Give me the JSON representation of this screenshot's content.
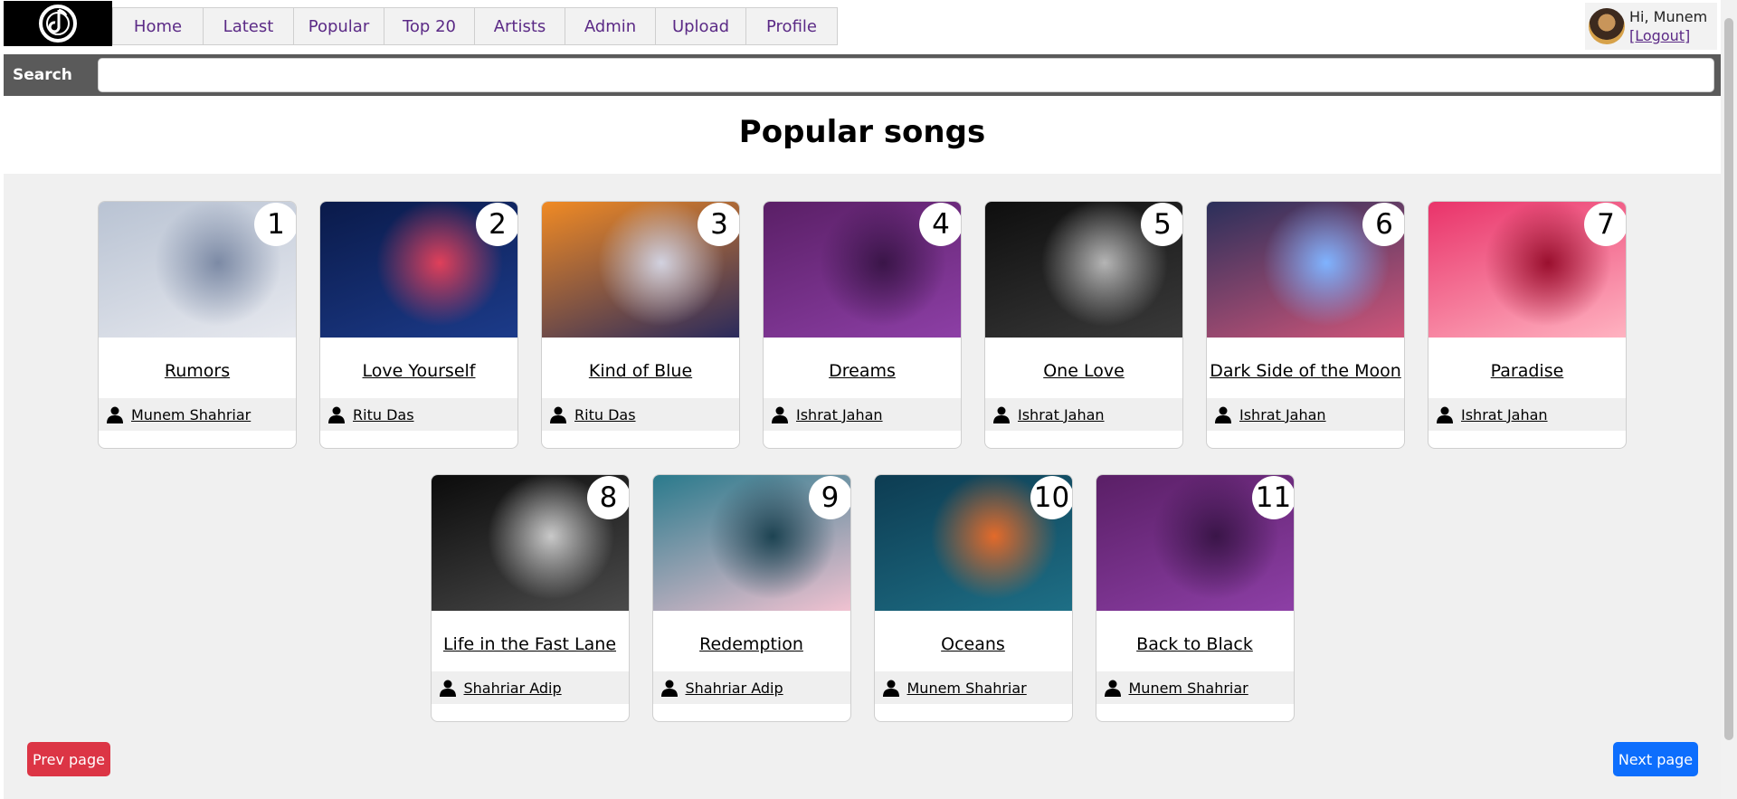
{
  "nav": {
    "items": [
      "Home",
      "Latest",
      "Popular",
      "Top 20",
      "Artists",
      "Admin",
      "Upload",
      "Profile"
    ]
  },
  "user": {
    "greeting": "Hi, Munem",
    "logout": "[Logout]"
  },
  "search": {
    "label": "Search",
    "value": ""
  },
  "page": {
    "title": "Popular songs"
  },
  "songs": [
    {
      "rank": "1",
      "title": "Rumors",
      "artist": "Munem Shahriar",
      "cover": [
        "#b9c3d3",
        "#e7e9ef",
        "#7c8aa5"
      ]
    },
    {
      "rank": "2",
      "title": "Love Yourself",
      "artist": "Ritu Das",
      "cover": [
        "#0a1a4a",
        "#1c3b8a",
        "#e0405a"
      ]
    },
    {
      "rank": "3",
      "title": "Kind of Blue",
      "artist": "Ritu Das",
      "cover": [
        "#f08a24",
        "#2a2a5c",
        "#d2d2e0"
      ]
    },
    {
      "rank": "4",
      "title": "Dreams",
      "artist": "Ishrat Jahan",
      "cover": [
        "#5a1f66",
        "#8d3fa6",
        "#3a1548"
      ]
    },
    {
      "rank": "5",
      "title": "One Love",
      "artist": "Ishrat Jahan",
      "cover": [
        "#0e0e0e",
        "#3a3a3a",
        "#b5b5b5"
      ]
    },
    {
      "rank": "6",
      "title": "Dark Side of the Moon",
      "artist": "Ishrat Jahan",
      "cover": [
        "#2a2f5a",
        "#d0567a",
        "#7fb3ff"
      ]
    },
    {
      "rank": "7",
      "title": "Paradise",
      "artist": "Ishrat Jahan",
      "cover": [
        "#e9336a",
        "#ffb3c1",
        "#9a0f2e"
      ]
    },
    {
      "rank": "8",
      "title": "Life in the Fast Lane",
      "artist": "Shahriar Adip",
      "cover": [
        "#0b0b0b",
        "#4b4b4b",
        "#c9c9c9"
      ]
    },
    {
      "rank": "9",
      "title": "Redemption",
      "artist": "Shahriar Adip",
      "cover": [
        "#2a7a8c",
        "#f1c2d1",
        "#1d4352"
      ]
    },
    {
      "rank": "10",
      "title": "Oceans",
      "artist": "Munem Shahriar",
      "cover": [
        "#0d3c52",
        "#1e6f86",
        "#e36a2a"
      ]
    },
    {
      "rank": "11",
      "title": "Back to Black",
      "artist": "Munem Shahriar",
      "cover": [
        "#5a1f66",
        "#8d3fa6",
        "#3a1548"
      ]
    }
  ],
  "pagination": {
    "prev": "Prev page",
    "next": "Next page"
  },
  "colors": {
    "nav_text": "#5b2a86",
    "prev_button": "#dc3545",
    "next_button": "#0d6efd"
  }
}
